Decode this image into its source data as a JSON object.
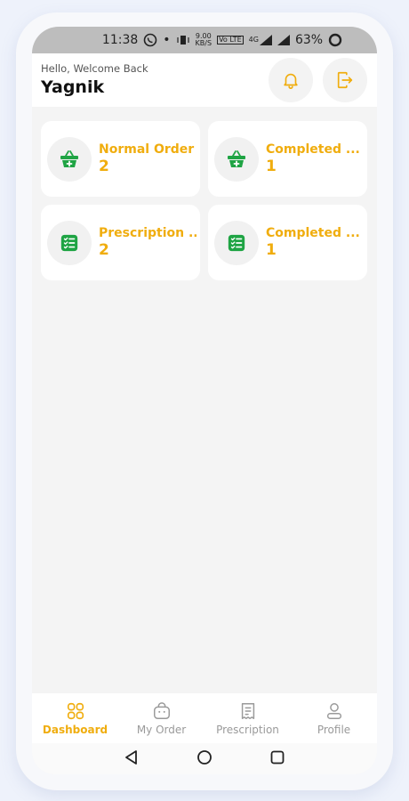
{
  "status_bar": {
    "time": "11:38",
    "dot": "•",
    "net_speed_value": "9.00",
    "net_speed_unit": "KB/S",
    "volte": "Vo LTE",
    "signal_type": "4G",
    "battery": "63%"
  },
  "header": {
    "greeting": "Hello, Welcome Back",
    "username": "Yagnik",
    "bell_icon": "bell-icon",
    "logout_icon": "logout-icon"
  },
  "cards": [
    {
      "title": "Normal Order",
      "count": "2",
      "icon": "basket-plus-icon"
    },
    {
      "title": "Completed ...",
      "count": "1",
      "icon": "basket-plus-icon"
    },
    {
      "title": "Prescription ...",
      "count": "2",
      "icon": "checklist-icon"
    },
    {
      "title": "Completed ...",
      "count": "1",
      "icon": "checklist-icon"
    }
  ],
  "bottom_nav": {
    "items": [
      {
        "label": "Dashboard",
        "icon": "grid-icon",
        "active": true
      },
      {
        "label": "My Order",
        "icon": "bag-icon",
        "active": false
      },
      {
        "label": "Prescription",
        "icon": "receipt-icon",
        "active": false
      },
      {
        "label": "Profile",
        "icon": "person-icon",
        "active": false
      }
    ]
  },
  "colors": {
    "accent": "#f0ad0e",
    "icon_green": "#1fa444",
    "inactive": "#9a9a9a"
  }
}
